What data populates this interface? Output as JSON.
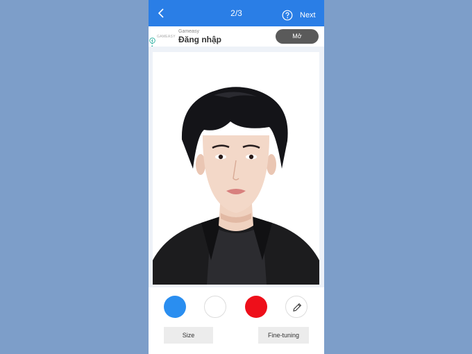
{
  "header": {
    "step": "2/3",
    "next_label": "Next",
    "bar_color": "#2a7ee6"
  },
  "ad": {
    "brand": "GAMEASY",
    "sponsor": "Gameasy",
    "title": "Đăng nhập",
    "cta": "Mở"
  },
  "colors": [
    {
      "name": "blue",
      "hex": "#2a8ef0"
    },
    {
      "name": "white",
      "hex": "#ffffff"
    },
    {
      "name": "red",
      "hex": "#ee0f1a"
    }
  ],
  "actions": {
    "size_label": "Size",
    "fine_tuning_label": "Fine-tuning"
  },
  "icons": [
    "back-icon",
    "help-icon",
    "ad-info-icon",
    "pencil-icon"
  ]
}
